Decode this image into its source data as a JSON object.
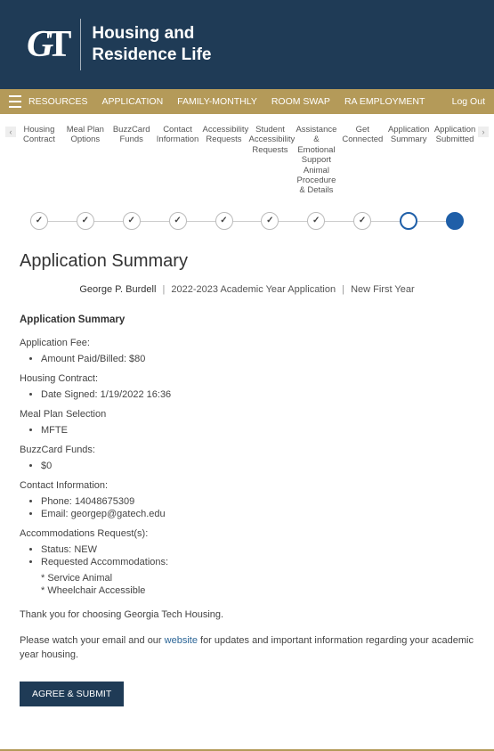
{
  "header": {
    "dept_title_line1": "Housing and",
    "dept_title_line2": "Residence Life"
  },
  "nav": {
    "items": [
      "RESOURCES",
      "APPLICATION",
      "FAMILY-MONTHLY",
      "ROOM SWAP",
      "RA EMPLOYMENT"
    ],
    "logout": "Log Out"
  },
  "steps": {
    "labels": [
      "Housing Contract",
      "Meal Plan Options",
      "BuzzCard Funds",
      "Contact Information",
      "Accessibility Requests",
      "Student Accessibility Requests",
      "Assistance & Emotional Support Animal Procedure & Details",
      "Get Connected",
      "Application Summary",
      "Application Submitted"
    ]
  },
  "page": {
    "title": "Application Summary",
    "applicant_name": "George P. Burdell",
    "term": "2022-2023 Academic Year Application",
    "student_type": "New First Year"
  },
  "summary": {
    "heading": "Application Summary",
    "app_fee_label": "Application Fee:",
    "amount_paid": "Amount Paid/Billed: $80",
    "housing_contract_label": "Housing Contract:",
    "date_signed": "Date Signed: 1/19/2022 16:36",
    "meal_plan_label": "Meal Plan Selection",
    "meal_plan_value": "MFTE",
    "buzzcard_label": "BuzzCard Funds:",
    "buzzcard_value": "$0",
    "contact_label": "Contact Information:",
    "phone_label": "Phone:",
    "phone_value": "14048675309",
    "email_label": "Email:",
    "email_value": "georgep@gatech.edu",
    "accommodations_label": "Accommodations Request(s):",
    "status_label": "Status:",
    "status_value": "NEW",
    "requested_label": "Requested Accommodations:",
    "req1": "* Service Animal",
    "req2": "* Wheelchair Accessible",
    "thanks": "Thank you for choosing Georgia Tech Housing.",
    "watch_pre": "Please watch your email and our ",
    "watch_link": "website",
    "watch_post": " for updates and important information regarding your academic year housing.",
    "submit_label": "AGREE & SUBMIT"
  }
}
